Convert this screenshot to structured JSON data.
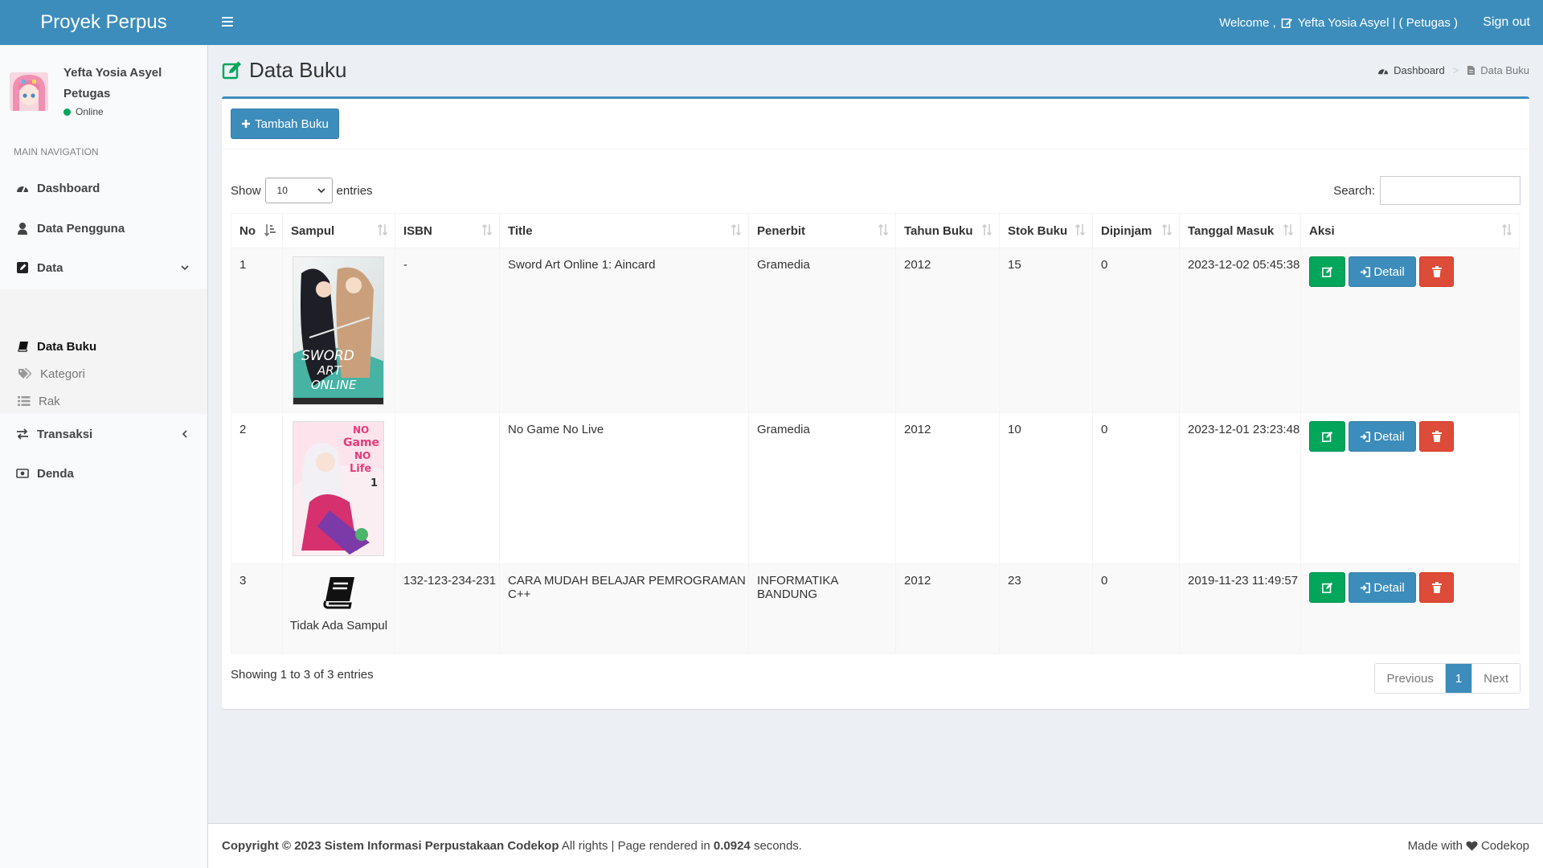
{
  "header": {
    "logo": "Proyek Perpus",
    "welcome": "Welcome ,",
    "user": "Yefta Yosia Asyel | ( Petugas )",
    "signout": "Sign out"
  },
  "sidebar": {
    "user_name": "Yefta Yosia Asyel",
    "user_role": "Petugas",
    "status": "Online",
    "nav_header": "MAIN NAVIGATION",
    "items": [
      {
        "label": "Dashboard",
        "icon": "dashboard-icon"
      },
      {
        "label": "Data Pengguna",
        "icon": "user-icon"
      },
      {
        "label": "Data",
        "icon": "edit-icon",
        "expanded": true
      },
      {
        "label": "Transaksi",
        "icon": "exchange-icon"
      },
      {
        "label": "Denda",
        "icon": "money-icon"
      }
    ],
    "subitems": [
      {
        "label": "Data Buku",
        "icon": "book-icon",
        "active": true
      },
      {
        "label": "Kategori",
        "icon": "tags-icon"
      },
      {
        "label": "Rak",
        "icon": "list-icon"
      }
    ]
  },
  "page": {
    "title": "Data Buku",
    "breadcrumb": [
      "Dashboard",
      "Data Buku"
    ]
  },
  "table_controls": {
    "add_button": "Tambah Buku",
    "show_label": "Show",
    "entries_value": "10",
    "entries_label": "entries",
    "search_label": "Search:",
    "search_value": ""
  },
  "table": {
    "columns": [
      "No",
      "Sampul",
      "ISBN",
      "Title",
      "Penerbit",
      "Tahun Buku",
      "Stok Buku",
      "Dipinjam",
      "Tanggal Masuk",
      "Aksi"
    ],
    "detail_label": "Detail",
    "no_cover_label": "Tidak Ada Sampul",
    "rows": [
      {
        "no": "1",
        "cover": "sao",
        "isbn": "-",
        "title": "Sword Art Online 1: Aincard",
        "penerbit": "Gramedia",
        "tahun": "2012",
        "stok": "15",
        "dipinjam": "0",
        "tanggal": "2023-12-02 05:45:38"
      },
      {
        "no": "2",
        "cover": "ngnl",
        "isbn": "",
        "title": "No Game No Live",
        "penerbit": "Gramedia",
        "tahun": "2012",
        "stok": "10",
        "dipinjam": "0",
        "tanggal": "2023-12-01 23:23:48"
      },
      {
        "no": "3",
        "cover": "none",
        "isbn": "132-123-234-231",
        "title": "CARA MUDAH BELAJAR PEMROGRAMAN C++",
        "penerbit": "INFORMATIKA BANDUNG",
        "tahun": "2012",
        "stok": "23",
        "dipinjam": "0",
        "tanggal": "2019-11-23 11:49:57"
      }
    ]
  },
  "pagination": {
    "info": "Showing 1 to 3 of 3 entries",
    "previous": "Previous",
    "current": "1",
    "next": "Next"
  },
  "footer": {
    "copyright": "Copyright © 2023 Sistem Informasi Perpustakaan Codekop",
    "rights": "All rights | Page rendered in",
    "time": "0.0924",
    "seconds": "seconds.",
    "made_with": "Made with",
    "brand": "Codekop"
  },
  "colors": {
    "primary": "#3c8dbc",
    "success": "#00a65a",
    "danger": "#dd4b39",
    "background": "#ecf0f5"
  }
}
